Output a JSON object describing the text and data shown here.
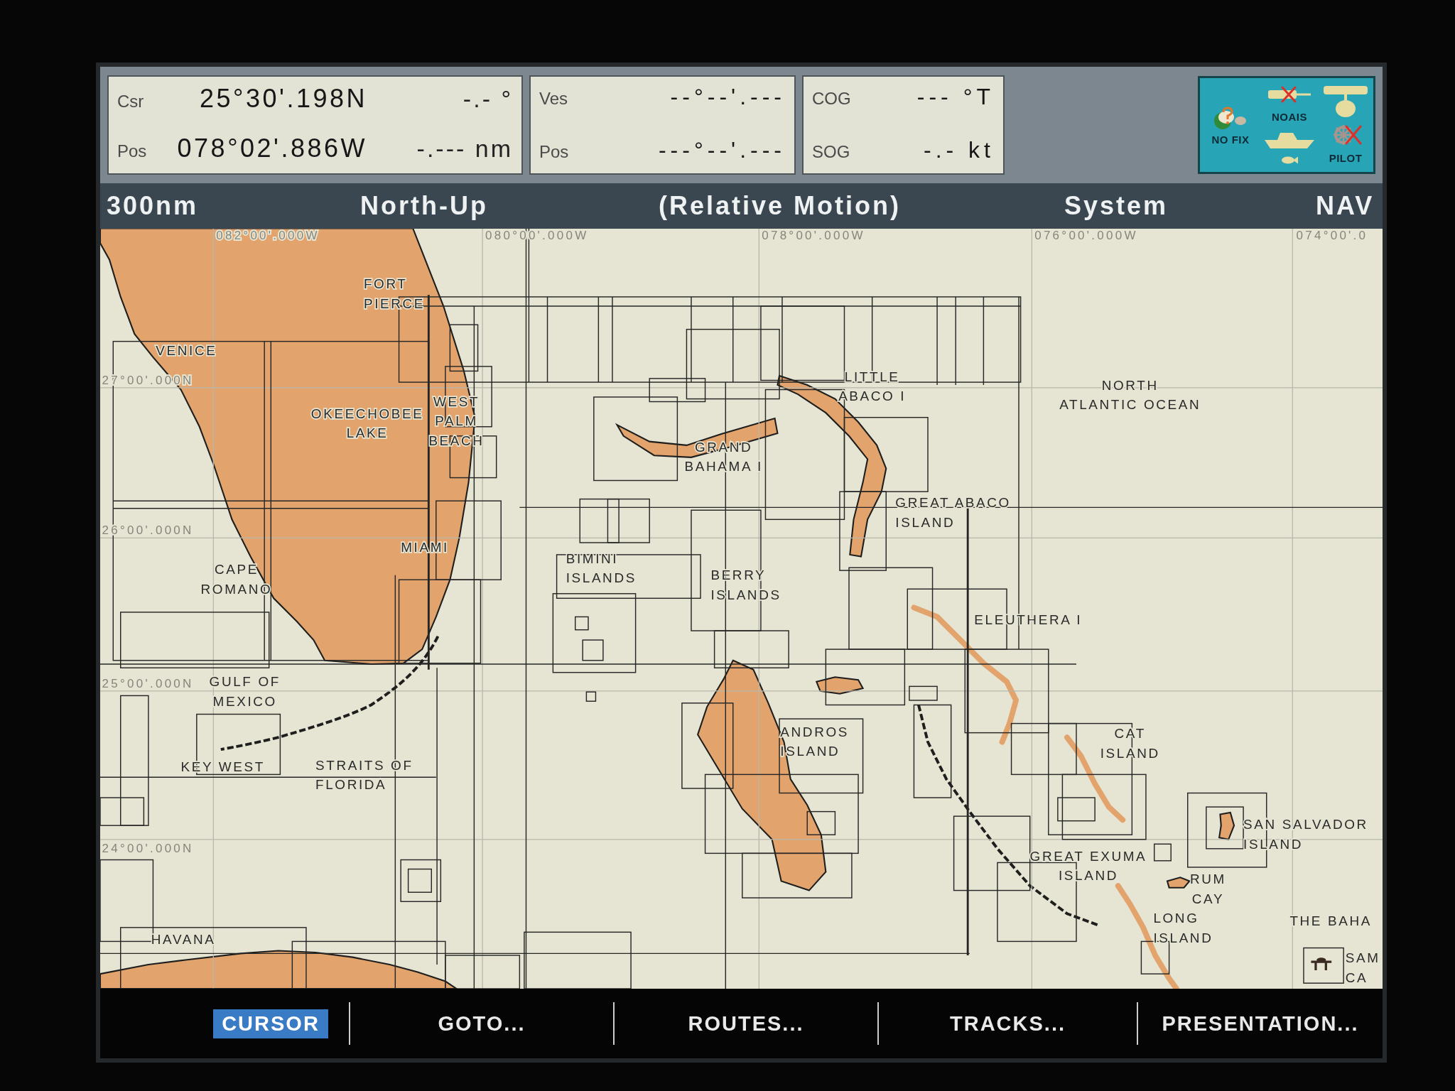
{
  "info_boxes": [
    {
      "rows": [
        {
          "label": "Csr",
          "value": "25°30'.198N",
          "reading": "-.- °"
        },
        {
          "label": "Pos",
          "value": "078°02'.886W",
          "reading": "-.--- nm"
        }
      ]
    },
    {
      "rows": [
        {
          "label": "Ves",
          "value": "--°--'.---"
        },
        {
          "label": "Pos",
          "value": "---°--'.---"
        }
      ]
    },
    {
      "rows": [
        {
          "label": "COG",
          "value": "--- °T"
        },
        {
          "label": "SOG",
          "value": "-.- kt"
        }
      ]
    }
  ],
  "status_icons": [
    {
      "kind": "gps",
      "label": "NO FIX",
      "crossed": false
    },
    {
      "kind": "ais",
      "label": "NOAIS",
      "crossed": true
    },
    {
      "kind": "radar",
      "crossed": false
    },
    {
      "kind": "vessel",
      "crossed": false
    },
    {
      "kind": "sonar",
      "crossed": false
    },
    {
      "kind": "pilot",
      "label": "PILOT",
      "crossed": true
    }
  ],
  "status_bar": {
    "range": "300nm",
    "orientation": "North-Up",
    "motion": "(Relative Motion)",
    "source": "System",
    "mode": "NAV"
  },
  "map": {
    "longitude_labels": [
      "082°00'.000W",
      "080°00'.000W",
      "078°00'.000W",
      "076°00'.000W",
      "074°00'.0"
    ],
    "latitude_labels": [
      "27°00'.000N",
      "26°00'.000N",
      "25°00'.000N",
      "24°00'.000N"
    ],
    "places": [
      {
        "lines": [
          "FORT",
          "PIERCE"
        ]
      },
      {
        "lines": [
          "VENICE"
        ]
      },
      {
        "lines": [
          "OKEECHOBEE",
          "LAKE"
        ]
      },
      {
        "lines": [
          "WEST",
          "PALM",
          "BEACH"
        ]
      },
      {
        "lines": [
          "MIAMI"
        ]
      },
      {
        "lines": [
          "CAPE",
          "ROMANO"
        ]
      },
      {
        "lines": [
          "GULF OF",
          "MEXICO"
        ]
      },
      {
        "lines": [
          "KEY WEST"
        ]
      },
      {
        "lines": [
          "STRAITS OF",
          "FLORIDA"
        ]
      },
      {
        "lines": [
          "HAVANA"
        ]
      },
      {
        "lines": [
          "BIMINI",
          "ISLANDS"
        ]
      },
      {
        "lines": [
          "GRAND",
          "BAHAMA I"
        ]
      },
      {
        "lines": [
          "LITTLE",
          "ABACO I"
        ]
      },
      {
        "lines": [
          "BERRY",
          "ISLANDS"
        ]
      },
      {
        "lines": [
          "GREAT ABACO",
          "ISLAND"
        ]
      },
      {
        "lines": [
          "NORTH",
          "ATLANTIC OCEAN"
        ]
      },
      {
        "lines": [
          "ELEUTHERA I"
        ]
      },
      {
        "lines": [
          "ANDROS",
          "ISLAND"
        ]
      },
      {
        "lines": [
          "CAT",
          "ISLAND"
        ]
      },
      {
        "lines": [
          "SAN SALVADOR",
          "ISLAND"
        ]
      },
      {
        "lines": [
          "GREAT EXUMA",
          "ISLAND"
        ]
      },
      {
        "lines": [
          "RUM",
          "CAY"
        ]
      },
      {
        "lines": [
          "LONG",
          "ISLAND"
        ]
      },
      {
        "lines": [
          "THE BAHA"
        ]
      },
      {
        "lines": [
          "SAM",
          "CA"
        ]
      }
    ]
  },
  "softkeys": [
    {
      "label": "CURSOR",
      "selected": true
    },
    {
      "label": "GOTO...",
      "selected": false
    },
    {
      "label": "ROUTES...",
      "selected": false
    },
    {
      "label": "TRACKS...",
      "selected": false
    },
    {
      "label": "PRESENTATION...",
      "selected": false
    }
  ]
}
